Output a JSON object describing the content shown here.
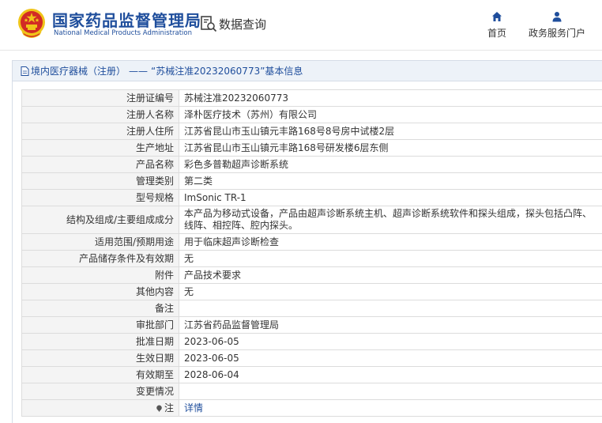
{
  "header": {
    "brand_cn": "国家药品监督管理局",
    "brand_en": "National Medical Products Administration",
    "query_label": "数据查询",
    "nav": [
      {
        "label": "首页",
        "icon": "home-icon"
      },
      {
        "label": "政务服务门户",
        "icon": "user-icon"
      }
    ]
  },
  "breadcrumb": {
    "category": "境内医疗器械（注册）",
    "separator": "——",
    "title": "“苏械注准20232060773”基本信息"
  },
  "rows": [
    {
      "label": "注册证编号",
      "value": "苏械注准20232060773"
    },
    {
      "label": "注册人名称",
      "value": "泽朴医疗技术（苏州）有限公司"
    },
    {
      "label": "注册人住所",
      "value": "江苏省昆山市玉山镇元丰路168号8号房中试楼2层"
    },
    {
      "label": "生产地址",
      "value": "江苏省昆山市玉山镇元丰路168号研发楼6层东侧"
    },
    {
      "label": "产品名称",
      "value": "彩色多普勒超声诊断系统"
    },
    {
      "label": "管理类别",
      "value": "第二类"
    },
    {
      "label": "型号规格",
      "value": "ImSonic TR-1"
    },
    {
      "label": "结构及组成/主要组成成分",
      "value": "本产品为移动式设备，产品由超声诊断系统主机、超声诊断系统软件和探头组成，探头包括凸阵、线阵、相控阵、腔内探头。"
    },
    {
      "label": "适用范围/预期用途",
      "value": "用于临床超声诊断检查"
    },
    {
      "label": "产品储存条件及有效期",
      "value": "无"
    },
    {
      "label": "附件",
      "value": "产品技术要求"
    },
    {
      "label": "其他内容",
      "value": "无"
    },
    {
      "label": "备注",
      "value": ""
    },
    {
      "label": "审批部门",
      "value": "江苏省药品监督管理局"
    },
    {
      "label": "批准日期",
      "value": "2023-06-05"
    },
    {
      "label": "生效日期",
      "value": "2023-06-05"
    },
    {
      "label": "有效期至",
      "value": "2028-06-04"
    },
    {
      "label": "变更情况",
      "value": ""
    }
  ],
  "detail_row": {
    "label": "注",
    "link": "详情",
    "icon": "pin-icon"
  },
  "colors": {
    "brand_blue": "#1f4e9c",
    "bar_bg": "#edf2f8",
    "label_bg": "#f4f4f4",
    "emblem_red": "#d22a25",
    "emblem_gold": "#f0c419"
  }
}
